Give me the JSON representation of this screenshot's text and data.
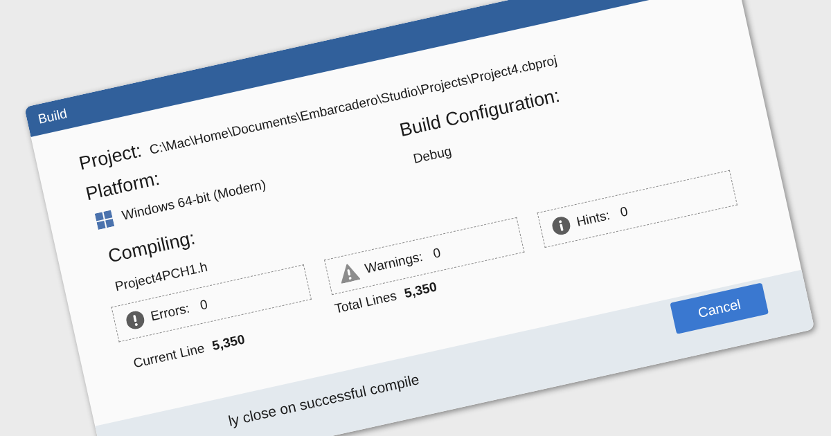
{
  "dialog": {
    "title": "Build"
  },
  "project": {
    "label": "Project:",
    "path": "C:\\Mac\\Home\\Documents\\Embarcadero\\Studio\\Projects\\Project4.cbproj"
  },
  "build_configuration": {
    "label": "Build Configuration:",
    "value": "Debug"
  },
  "platform": {
    "label": "Platform:",
    "value": "Windows 64-bit (Modern)"
  },
  "compiling": {
    "label": "Compiling:",
    "file": "Project4PCH1.h"
  },
  "counters": [
    {
      "kind": "error",
      "label": "Errors:",
      "value": "0"
    },
    {
      "kind": "warning",
      "label": "Warnings:",
      "value": "0"
    },
    {
      "kind": "hint",
      "label": "Hints:",
      "value": "0"
    }
  ],
  "line_stats": [
    {
      "label": "Current Line",
      "value": "5,350"
    },
    {
      "label": "Total Lines",
      "value": "5,350"
    }
  ],
  "auto_close": {
    "label": "ly close on successful compile"
  },
  "buttons": [
    {
      "label": "Cancel"
    }
  ]
}
